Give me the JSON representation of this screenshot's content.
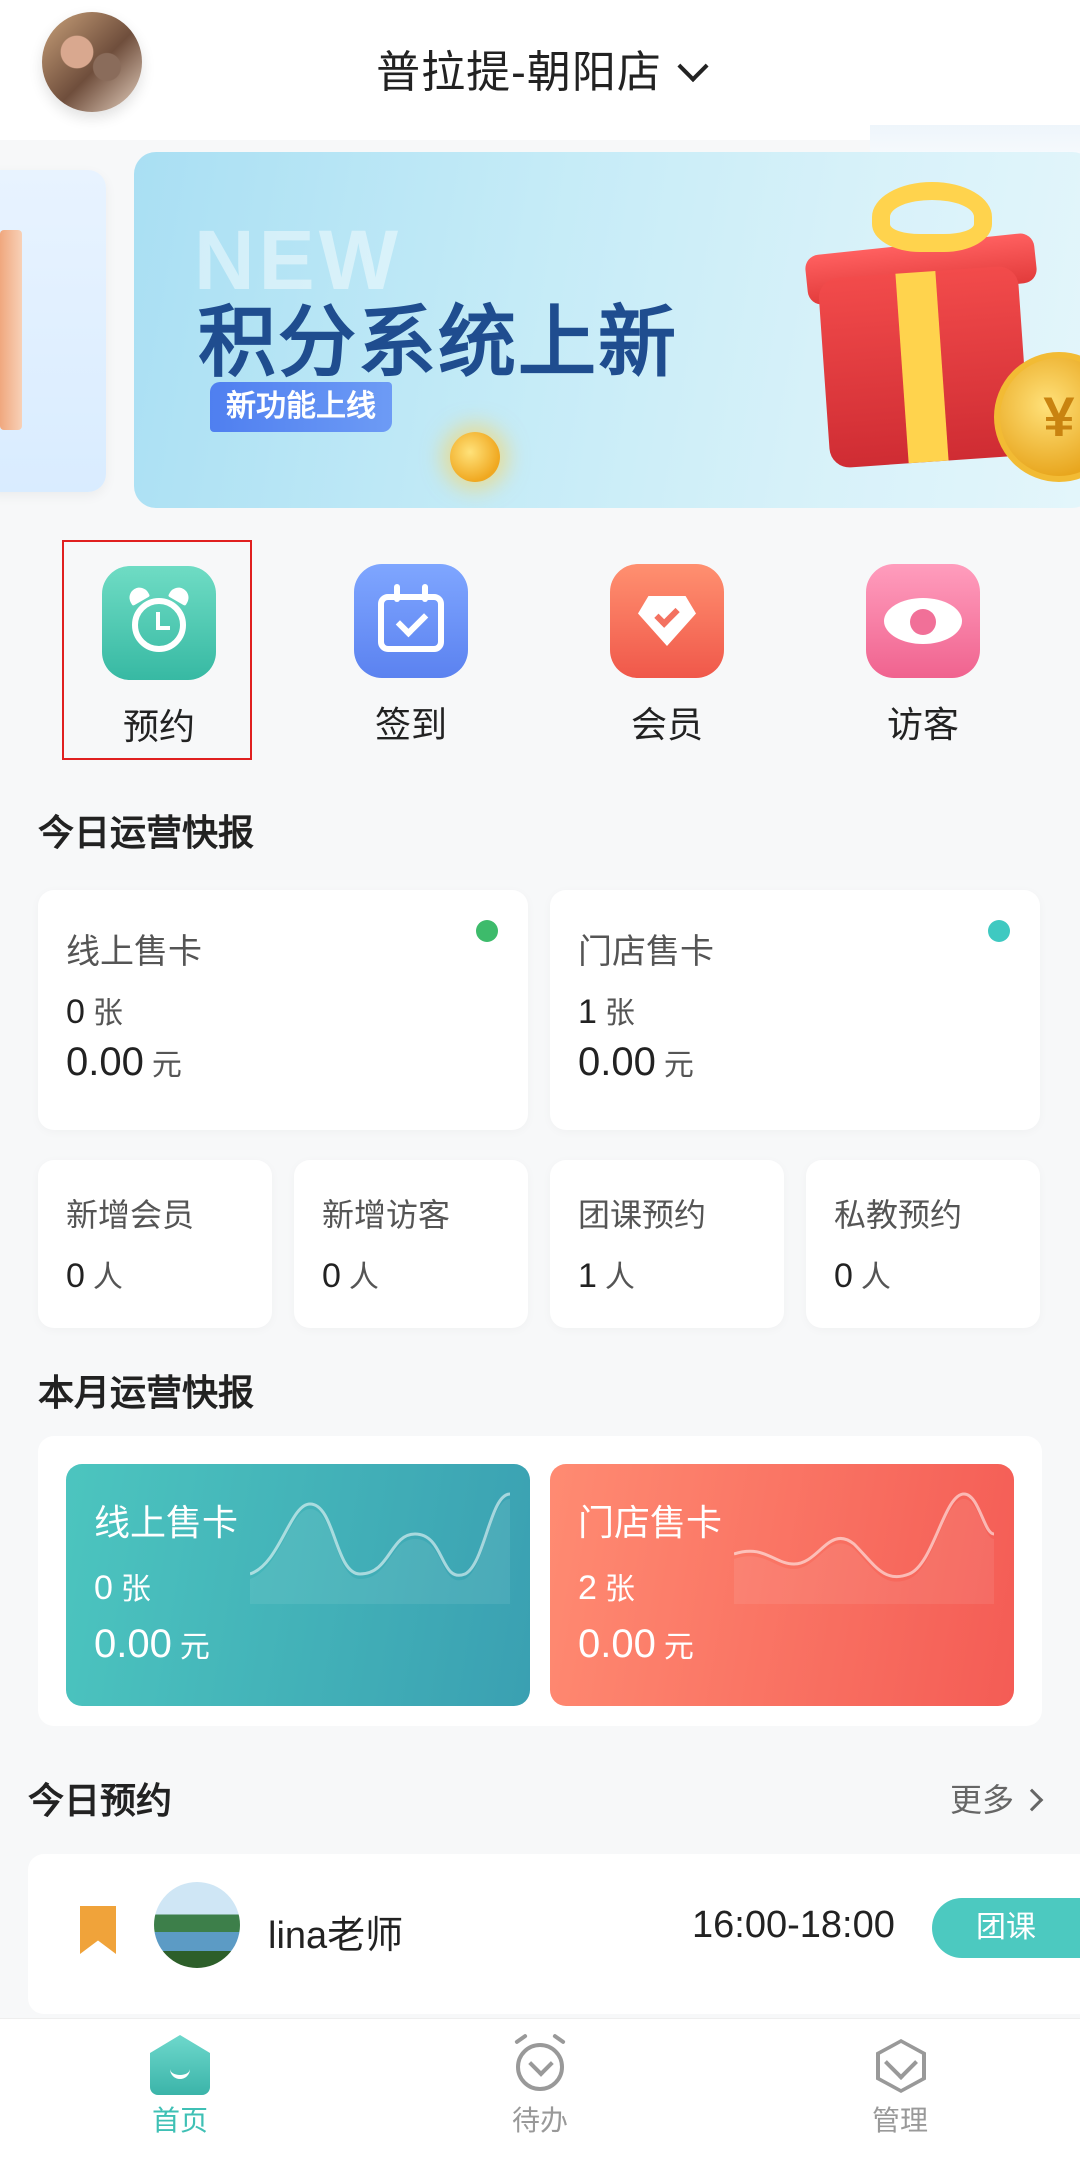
{
  "header": {
    "store_name": "普拉提-朝阳店"
  },
  "banner": {
    "ghost_text": "NEW",
    "title": "积分系统上新",
    "subtitle": "新功能上线",
    "coin_symbol": "¥",
    "slide_count": 3,
    "active_slide": 1
  },
  "quick_actions": [
    {
      "label": "预约",
      "icon": "alarm-clock-icon",
      "color": "#3fbfaa"
    },
    {
      "label": "签到",
      "icon": "calendar-check-icon",
      "color": "#6a90f5"
    },
    {
      "label": "会员",
      "icon": "diamond-icon",
      "color": "#f46a58"
    },
    {
      "label": "访客",
      "icon": "eye-icon",
      "color": "#f27aa0"
    }
  ],
  "today": {
    "title": "今日运营快报",
    "online": {
      "label": "线上售卡",
      "count": "0",
      "count_unit": "张",
      "amount": "0.00",
      "amount_unit": "元",
      "dot_color": "#3dbb6b"
    },
    "store": {
      "label": "门店售卡",
      "count": "1",
      "count_unit": "张",
      "amount": "0.00",
      "amount_unit": "元",
      "dot_color": "#3fc9c1"
    },
    "stats": [
      {
        "label": "新增会员",
        "value": "0",
        "unit": "人"
      },
      {
        "label": "新增访客",
        "value": "0",
        "unit": "人"
      },
      {
        "label": "团课预约",
        "value": "1",
        "unit": "人"
      },
      {
        "label": "私教预约",
        "value": "0",
        "unit": "人"
      }
    ]
  },
  "month": {
    "title": "本月运营快报",
    "online": {
      "label": "线上售卡",
      "count": "0",
      "count_unit": "张",
      "amount": "0.00",
      "amount_unit": "元"
    },
    "store": {
      "label": "门店售卡",
      "count": "2",
      "count_unit": "张",
      "amount": "0.00",
      "amount_unit": "元"
    }
  },
  "appointments": {
    "title": "今日预约",
    "more_label": "更多",
    "items": [
      {
        "teacher": "lina老师",
        "time": "16:00-18:00",
        "tag": "团课"
      }
    ]
  },
  "tabbar": {
    "items": [
      {
        "label": "首页",
        "icon": "home-icon",
        "active": true
      },
      {
        "label": "待办",
        "icon": "todo-clock-icon",
        "active": false
      },
      {
        "label": "管理",
        "icon": "manage-icon",
        "active": false
      }
    ]
  },
  "colors": {
    "accent": "#3fc0b5",
    "selection_border": "#e02020"
  }
}
